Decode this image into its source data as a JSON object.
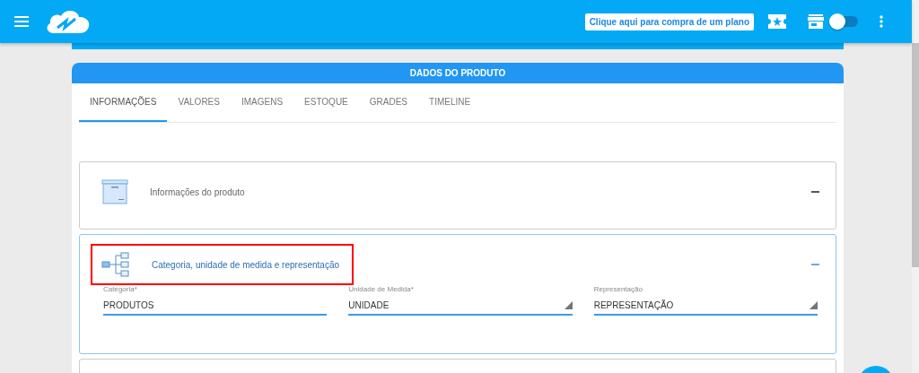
{
  "topbar": {
    "plan_button": "Clique aqui para compra de um plano",
    "toggle": {
      "on": false
    }
  },
  "card": {
    "title": "DADOS DO PRODUTO",
    "tabs": [
      {
        "label": "INFORMAÇÕES",
        "selected": true
      },
      {
        "label": "VALORES",
        "selected": false
      },
      {
        "label": "IMAGENS",
        "selected": false
      },
      {
        "label": "ESTOQUE",
        "selected": false
      },
      {
        "label": "GRADES",
        "selected": false
      },
      {
        "label": "TIMELINE",
        "selected": false
      }
    ],
    "panels": [
      {
        "kind": "box",
        "title": "Informações do produto",
        "active": false,
        "highlighted": false
      },
      {
        "kind": "tree",
        "title": "Categoria, unidade de medida e representação",
        "active": true,
        "highlighted": true,
        "fields": [
          {
            "kind": "text",
            "label": "Categoria*",
            "value": "PRODUTOS"
          },
          {
            "kind": "select",
            "label": "Unidade de Medida*",
            "value": "UNIDADE"
          },
          {
            "kind": "select",
            "label": "Representação",
            "value": "REPRESENTAÇÃO"
          }
        ]
      }
    ]
  }
}
